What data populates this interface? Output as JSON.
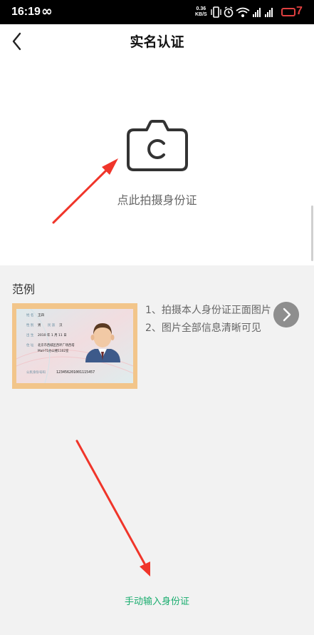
{
  "status_bar": {
    "time": "16:19",
    "infinity": "∞",
    "net_speed_value": "0.36",
    "net_speed_unit": "KB/S",
    "battery_level": "7"
  },
  "header": {
    "title": "实名认证"
  },
  "photo": {
    "label": "点此拍摄身份证"
  },
  "example": {
    "title": "范例",
    "instructions": [
      "1、拍摄本人身份证正面图片",
      "2、图片全部信息清晰可见"
    ],
    "card": {
      "fields": [
        {
          "label": "姓 名",
          "value": "王四"
        },
        {
          "label": "性 别",
          "value": "男"
        },
        {
          "label": "民 族",
          "value": "汉"
        },
        {
          "label": "出 生",
          "value": "2010 年 1 月 11 日"
        },
        {
          "label": "住 址",
          "value": "北京市西城区西环广场西塔"
        },
        {
          "label": "",
          "value": "Mall-T1办公楼1102室"
        }
      ],
      "id_label": "公民身份号码",
      "id_number": "123456201001115457"
    }
  },
  "footer": {
    "manual_link": "手动输入身份证"
  },
  "colors": {
    "accent_green": "#1aad6f",
    "battery_red": "#e04040",
    "annotation_arrow": "#f0352a"
  }
}
